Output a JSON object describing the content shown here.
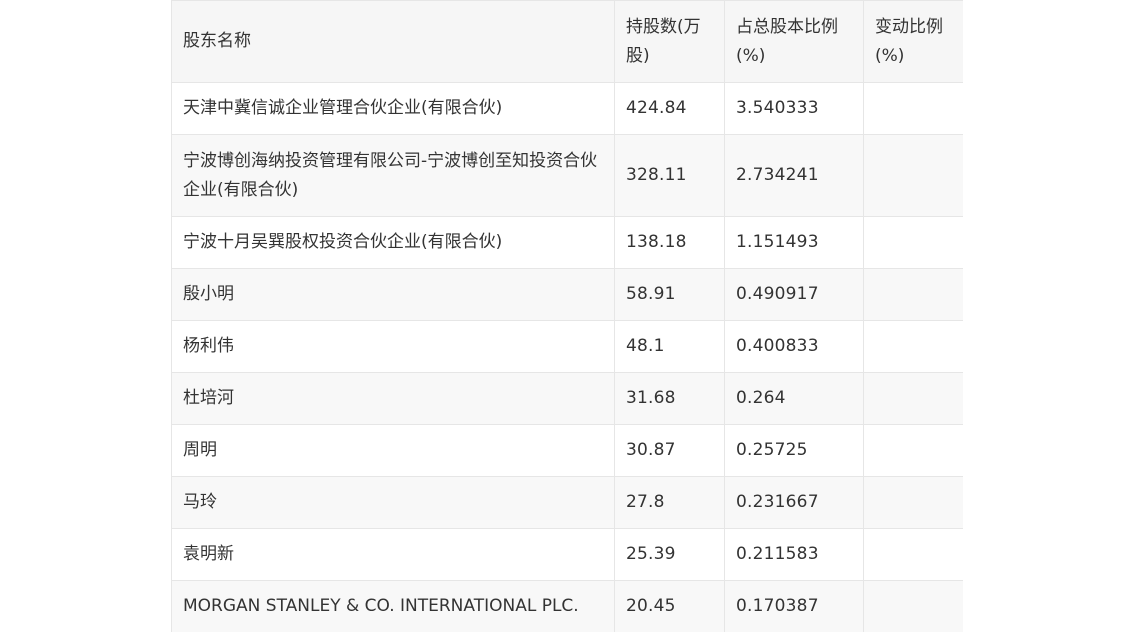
{
  "table": {
    "headers": [
      "股东名称",
      "持股数(万股)",
      "占总股本比例(%)",
      "变动比例(%)"
    ],
    "rows": [
      {
        "name": "天津中冀信诚企业管理合伙企业(有限合伙)",
        "shares": "424.84",
        "ratio": "3.540333",
        "change": ""
      },
      {
        "name": "宁波博创海纳投资管理有限公司-宁波博创至知投资合伙企业(有限合伙)",
        "shares": "328.11",
        "ratio": "2.734241",
        "change": ""
      },
      {
        "name": "宁波十月吴巽股权投资合伙企业(有限合伙)",
        "shares": "138.18",
        "ratio": "1.151493",
        "change": ""
      },
      {
        "name": "殷小明",
        "shares": "58.91",
        "ratio": "0.490917",
        "change": ""
      },
      {
        "name": "杨利伟",
        "shares": "48.1",
        "ratio": "0.400833",
        "change": ""
      },
      {
        "name": "杜培河",
        "shares": "31.68",
        "ratio": "0.264",
        "change": ""
      },
      {
        "name": "周明",
        "shares": "30.87",
        "ratio": "0.25725",
        "change": ""
      },
      {
        "name": "马玲",
        "shares": "27.8",
        "ratio": "0.231667",
        "change": ""
      },
      {
        "name": "袁明新",
        "shares": "25.39",
        "ratio": "0.211583",
        "change": ""
      },
      {
        "name": "MORGAN STANLEY & CO. INTERNATIONAL PLC.",
        "shares": "20.45",
        "ratio": "0.170387",
        "change": ""
      }
    ]
  }
}
